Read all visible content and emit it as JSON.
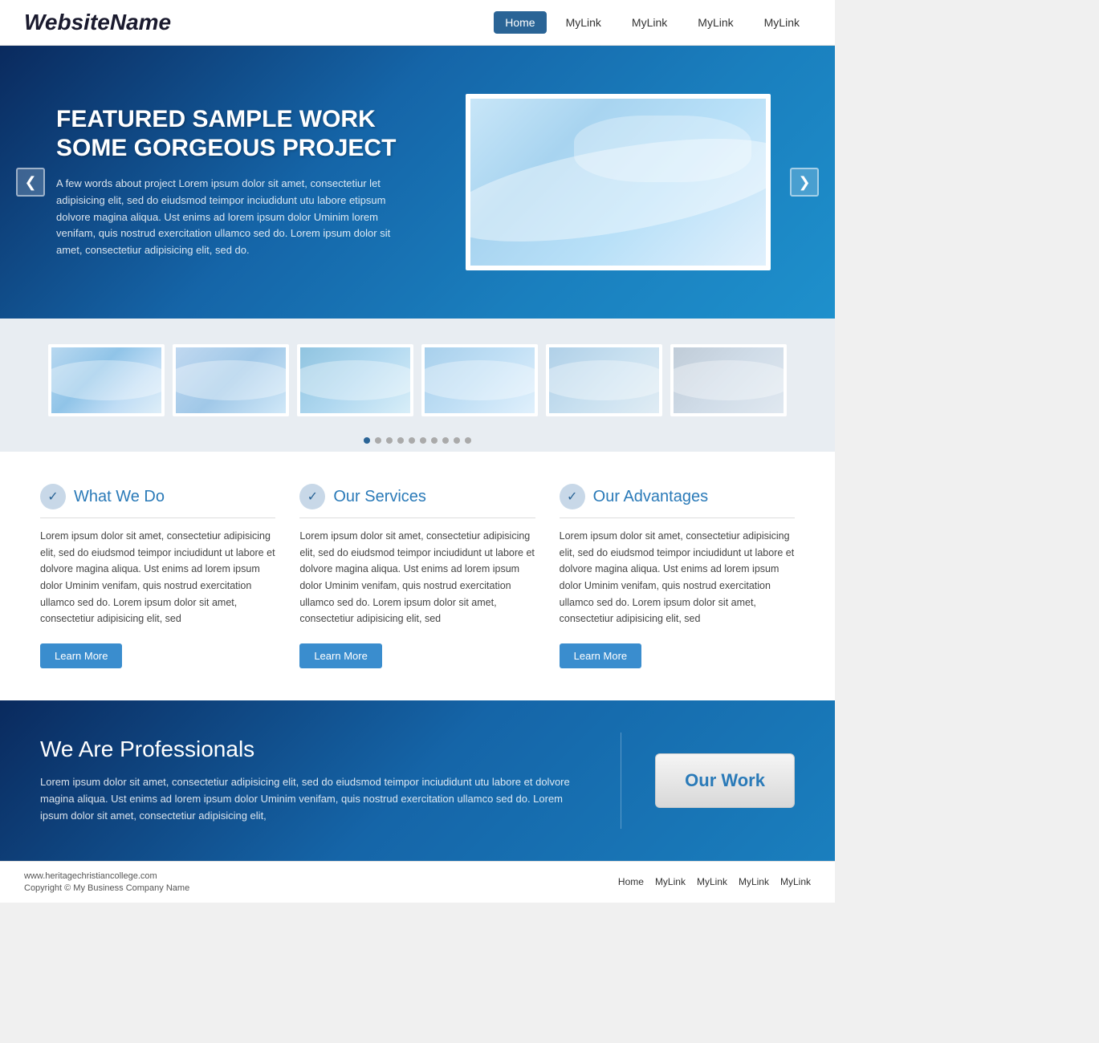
{
  "header": {
    "logo": "WebsiteName",
    "nav": {
      "home": "Home",
      "link1": "MyLink",
      "link2": "MyLink",
      "link3": "MyLink",
      "link4": "MyLink"
    }
  },
  "hero": {
    "title_line1": "FEATURED SAMPLE WORK",
    "title_line2": "SOME GORGEOUS PROJECT",
    "description": "A few words about project Lorem ipsum dolor sit amet, consectetiur  let adipisicing elit, sed do eiudsmod teimpor inciudidunt utu labore etipsum dolvore magina aliqua. Ust enims ad lorem ipsum dolor Uminim  lorem venifam, quis nostrud exercitation ullamco  sed do.  Lorem ipsum dolor sit amet, consectetiur adipisicing elit, sed do.",
    "prev_label": "❮",
    "next_label": "❯"
  },
  "gallery": {
    "dots_count": 10
  },
  "features": {
    "col1": {
      "title": "What We Do",
      "body": "Lorem ipsum dolor sit amet, consectetiur adipisicing elit, sed do eiudsmod teimpor inciudidunt ut labore et dolvore magina aliqua. Ust enims ad lorem ipsum dolor Uminim venifam, quis nostrud exercitation ullamco  sed do.  Lorem ipsum dolor sit amet, consectetiur adipisicing elit, sed",
      "btn": "Learn More"
    },
    "col2": {
      "title": "Our Services",
      "body": "Lorem ipsum dolor sit amet, consectetiur adipisicing elit, sed do eiudsmod teimpor inciudidunt ut labore et dolvore magina aliqua. Ust enims ad lorem ipsum dolor Uminim venifam, quis nostrud exercitation ullamco  sed do.  Lorem ipsum dolor sit amet, consectetiur adipisicing elit, sed",
      "btn": "Learn More"
    },
    "col3": {
      "title": "Our Advantages",
      "body": "Lorem ipsum dolor sit amet, consectetiur adipisicing elit, sed do eiudsmod teimpor inciudidunt ut labore et dolvore magina aliqua. Ust enims ad lorem ipsum dolor Uminim venifam, quis nostrud exercitation ullamco  sed do.  Lorem ipsum dolor sit amet, consectetiur adipisicing elit, sed",
      "btn": "Learn More"
    }
  },
  "dark_section": {
    "title": "We Are Professionals",
    "body": "Lorem ipsum dolor sit amet, consectetiur adipisicing elit, sed do eiudsmod teimpor inciudidunt utu labore et dolvore magina aliqua. Ust enims ad lorem ipsum dolor Uminim venifam, quis nostrud exercitation ullamco  sed do.  Lorem ipsum dolor sit amet, consectetiur adipisicing elit,",
    "cta_btn": "Our Work"
  },
  "footer": {
    "website": "www.heritagechristiancollege.com",
    "copyright": "Copyright © My Business Company Name",
    "nav": {
      "home": "Home",
      "link1": "MyLink",
      "link2": "MyLink",
      "link3": "MyLink",
      "link4": "MyLink"
    }
  }
}
